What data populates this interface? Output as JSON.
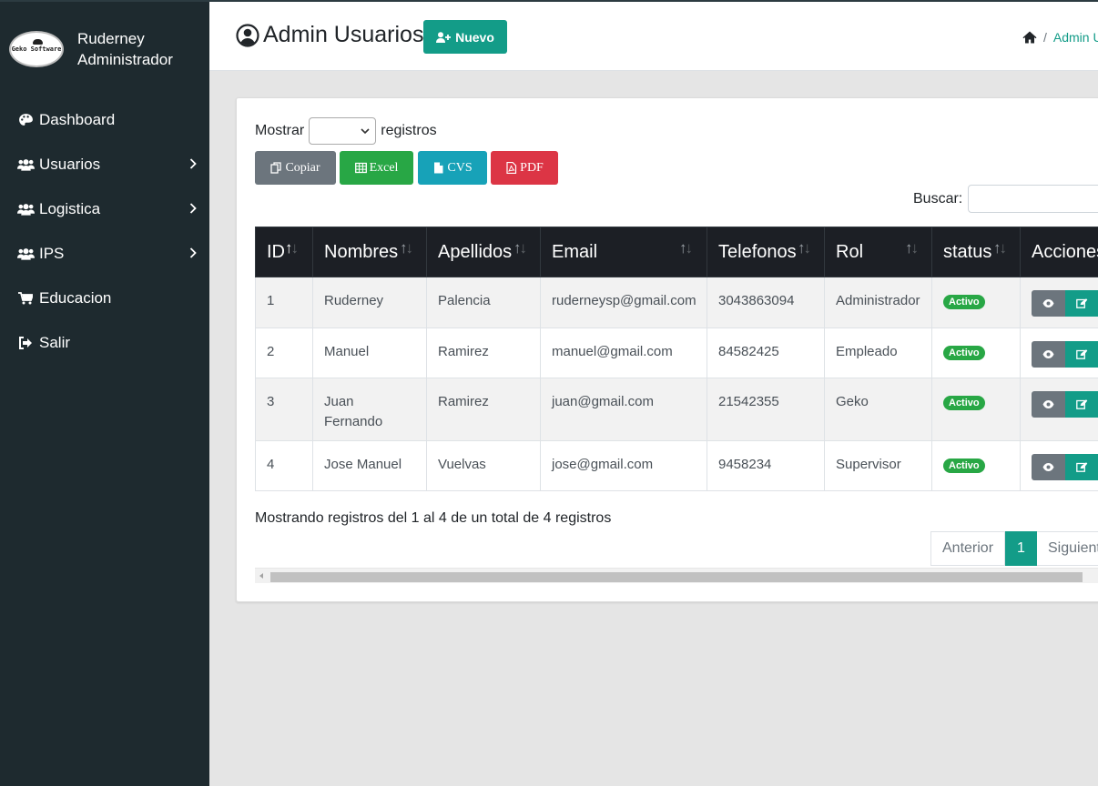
{
  "sidebar": {
    "logo_text": "Geko Software",
    "user_name": "Ruderney",
    "user_role": "Administrador",
    "items": [
      {
        "label": "Dashboard",
        "icon": "palette-icon",
        "submenu": false
      },
      {
        "label": "Usuarios",
        "icon": "users-icon",
        "submenu": true
      },
      {
        "label": "Logistica",
        "icon": "users-icon",
        "submenu": true
      },
      {
        "label": "IPS",
        "icon": "users-icon",
        "submenu": true
      },
      {
        "label": "Educacion",
        "icon": "cart-icon",
        "submenu": false
      },
      {
        "label": "Salir",
        "icon": "sign-out-icon",
        "submenu": false
      }
    ]
  },
  "header": {
    "title": "Admin Usuarios",
    "new_button": "Nuevo",
    "breadcrumb_current": "Admin Usuarios",
    "breadcrumb_sep": "/"
  },
  "controls": {
    "show_label": "Mostrar",
    "records_label": "registros",
    "search_label": "Buscar:",
    "search_value": ""
  },
  "export_buttons": {
    "copy": "Copiar",
    "excel": "Excel",
    "cvs": "CVS",
    "pdf": "PDF"
  },
  "table": {
    "columns": [
      "ID",
      "Nombres",
      "Apellidos",
      "Email",
      "Telefonos",
      "Rol",
      "status",
      "Acciones"
    ],
    "rows": [
      {
        "id": "1",
        "nombres": "Ruderney",
        "apellidos": "Palencia",
        "email": "ruderneysp@gmail.com",
        "telefonos": "3043863094",
        "rol": "Administrador",
        "status": "Activo"
      },
      {
        "id": "2",
        "nombres": "Manuel",
        "apellidos": "Ramirez",
        "email": "manuel@gmail.com",
        "telefonos": "84582425",
        "rol": "Empleado",
        "status": "Activo"
      },
      {
        "id": "3",
        "nombres": "Juan Fernando",
        "apellidos": "Ramirez",
        "email": "juan@gmail.com",
        "telefonos": "21542355",
        "rol": "Geko",
        "status": "Activo"
      },
      {
        "id": "4",
        "nombres": "Jose Manuel",
        "apellidos": "Vuelvas",
        "email": "jose@gmail.com",
        "telefonos": "9458234",
        "rol": "Supervisor",
        "status": "Activo"
      }
    ]
  },
  "footer": {
    "info": "Mostrando registros del 1 al 4 de un total de 4 registros",
    "prev": "Anterior",
    "page": "1",
    "next": "Siguiente"
  },
  "colors": {
    "sidebar_bg": "#1e2a2f",
    "accent": "#139c88",
    "badge_green": "#28a745",
    "table_header": "#1c1f25"
  }
}
